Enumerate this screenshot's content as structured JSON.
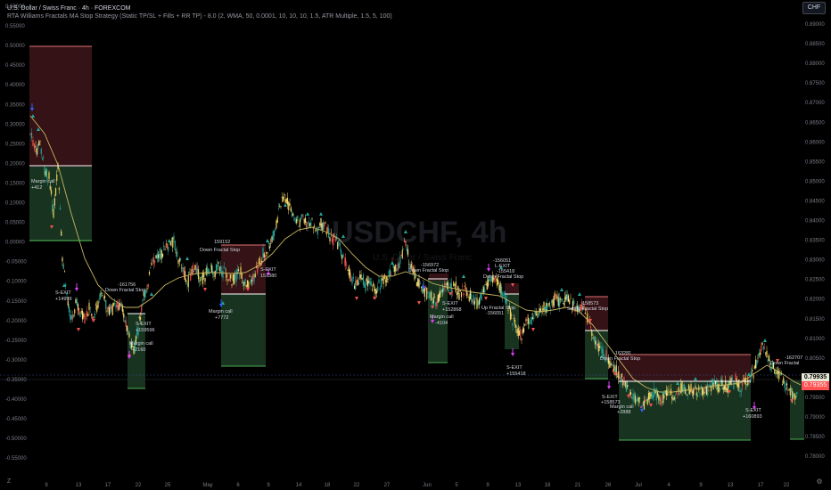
{
  "header": {
    "title": "U.S. Dollar / Swiss Franc · 4h · FOREXCOM",
    "strategy": "RTA Williams Fractals MA Stop Strategy (Static TP/SL + Fills + RR TP) - 8.0 (2, WMA, 50, 0.0001, 10, 10, 10, 1.5, ATR Multiple, 1.5, 5, 100)",
    "currency": "CHF"
  },
  "watermark": "USDCHF, 4h",
  "watermark_sub": "U.S. Dollar / Swiss Franc",
  "left_axis": [
    "0.60000",
    "0.55000",
    "0.50000",
    "0.45000",
    "0.40000",
    "0.35000",
    "0.30000",
    "0.25000",
    "0.20000",
    "0.15000",
    "0.10000",
    "0.05000",
    "0.00000",
    "-0.05000",
    "-0.10000",
    "-0.15000",
    "-0.20000",
    "-0.25000",
    "-0.30000",
    "-0.35000",
    "-0.40000",
    "-0.45000",
    "-0.50000",
    "-0.55000"
  ],
  "right_axis": [
    "0.89000",
    "0.88500",
    "0.88000",
    "0.87500",
    "0.87000",
    "0.86500",
    "0.86000",
    "0.85500",
    "0.85000",
    "0.84500",
    "0.84000",
    "0.83500",
    "0.83000",
    "0.82500",
    "0.82000",
    "0.81500",
    "0.81000",
    "0.80500",
    "0.80000",
    "0.79500",
    "0.79000",
    "0.78500",
    "0.78000"
  ],
  "current_price": "0.79935",
  "current_price_2": "0.79355",
  "time_axis": [
    "9",
    "13",
    "17",
    "22",
    "25",
    "May",
    "6",
    "9",
    "14",
    "18",
    "22",
    "27",
    "Jun",
    "5",
    "9",
    "13",
    "18",
    "21",
    "26",
    "Jul",
    "4",
    "9",
    "13",
    "17",
    "22"
  ],
  "annotations": [
    {
      "text": "Margin call"
    },
    {
      "text": "+412"
    },
    {
      "text": "S-EXIT"
    },
    {
      "text": "+14999"
    },
    {
      "text": "-161756"
    },
    {
      "text": "Down Fractal Stop"
    },
    {
      "text": "S-EXIT"
    },
    {
      "text": "+159596"
    },
    {
      "text": "Margin call"
    },
    {
      "text": "+2160"
    },
    {
      "text": "159152"
    },
    {
      "text": "Down Fractal Stop"
    },
    {
      "text": "S-EXIT"
    },
    {
      "text": "151380"
    },
    {
      "text": "Margin call"
    },
    {
      "text": "+7772"
    },
    {
      "text": "-156972"
    },
    {
      "text": "Down Fractal Stop"
    },
    {
      "text": "S-EXIT"
    },
    {
      "text": "+152868"
    },
    {
      "text": "Margin call"
    },
    {
      "text": "-4104"
    },
    {
      "text": "-156051"
    },
    {
      "text": "L-EXIT"
    },
    {
      "text": "-155418"
    },
    {
      "text": "Down Fractal Stop"
    },
    {
      "text": "Up Fractal Stop"
    },
    {
      "text": "-156051"
    },
    {
      "text": "S-EXIT"
    },
    {
      "text": "+155418"
    },
    {
      "text": "158573"
    },
    {
      "text": "Swing Fractal Stop"
    },
    {
      "text": "-163281"
    },
    {
      "text": "Down Fractal Stop"
    },
    {
      "text": "S-EXIT"
    },
    {
      "text": "+158573"
    },
    {
      "text": "Margin call"
    },
    {
      "text": "+2888"
    },
    {
      "text": "-162707"
    },
    {
      "text": "Down Fractal"
    },
    {
      "text": "S-EXIT"
    },
    {
      "text": "+160893"
    }
  ],
  "colors": {
    "background": "#000000",
    "up": "#26a69a",
    "down": "#ef5350",
    "ma": "#c8b560",
    "tp_zone": "#1b3a24",
    "sl_zone": "#3a1418"
  }
}
